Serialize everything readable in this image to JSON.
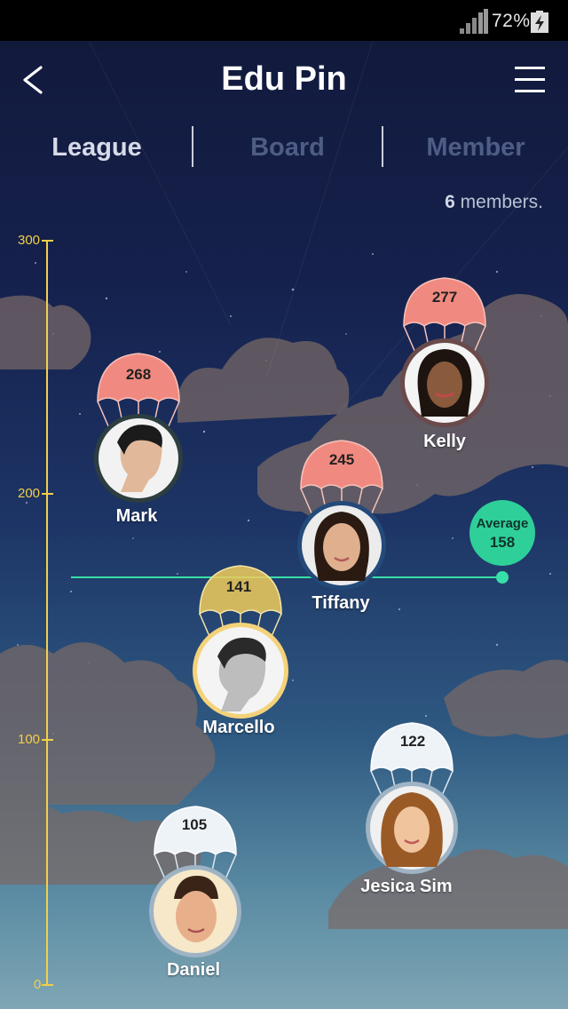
{
  "status_bar": {
    "battery_percent": "72%",
    "signal_icon": "signal-icon",
    "battery_icon": "battery-charging-icon"
  },
  "header": {
    "title": "Edu Pin",
    "back_icon": "back-arrow-icon",
    "menu_icon": "menu-icon"
  },
  "tabs": [
    {
      "label": "League",
      "active": true
    },
    {
      "label": "Board",
      "active": false
    },
    {
      "label": "Member",
      "active": false
    }
  ],
  "member_summary": {
    "count": "6",
    "suffix": " members."
  },
  "axis": {
    "ticks": [
      "300",
      "200",
      "100",
      "0"
    ]
  },
  "average": {
    "label": "Average",
    "value": "158"
  },
  "members": [
    {
      "name": "Mark",
      "score": "268",
      "parachute_color": "#f08a80"
    },
    {
      "name": "Kelly",
      "score": "277",
      "parachute_color": "#f08a80"
    },
    {
      "name": "Tiffany",
      "score": "245",
      "parachute_color": "#f08a80"
    },
    {
      "name": "Marcello",
      "score": "141",
      "parachute_color": "#f0cd5a"
    },
    {
      "name": "Jesica Sim",
      "score": "122",
      "parachute_color": "#eef3f8"
    },
    {
      "name": "Daniel",
      "score": "105",
      "parachute_color": "#eef3f8"
    }
  ],
  "colors": {
    "accent": "#2fcf9a",
    "axis": "#f2cf4a",
    "high": "#f08a80",
    "mid": "#f0cd5a",
    "low": "#eef3f8"
  }
}
